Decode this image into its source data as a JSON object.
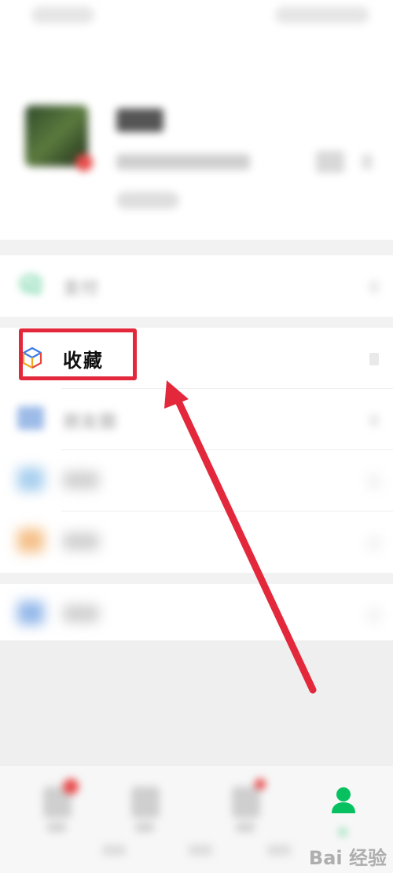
{
  "menu": {
    "pay_label": "支付",
    "favorites_label": "收藏",
    "moments_label": "朋友圈"
  },
  "tabbar": {
    "me_label": "我"
  },
  "watermark": {
    "text": "Bai 经验"
  },
  "colors": {
    "wechat_green": "#07c160",
    "highlight_red": "#e3283c",
    "annotation_arrow": "#e3283c"
  },
  "icons": {
    "pay": "wechat-pay-icon",
    "favorites": "favorites-cube-icon",
    "moments": "moments-icon",
    "me": "person-icon"
  }
}
